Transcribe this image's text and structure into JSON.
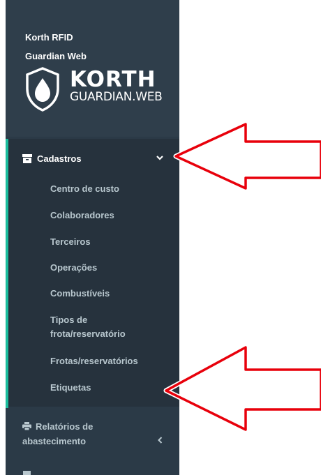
{
  "brand": {
    "line1": "Korth RFID",
    "line2": "Guardian Web",
    "logo_word1": "KORTH",
    "logo_word2": "GUARDIAN.WEB",
    "logo_icon": "shield-drop-icon"
  },
  "menu": {
    "active_section": {
      "label": "Cadastros",
      "icon": "archive-icon",
      "chevron": "chevron-down-icon",
      "items": [
        "Centro de custo",
        "Colaboradores",
        "Terceiros",
        "Operações",
        "Combustíveis",
        "Tipos de frota/reservatório",
        "Frotas/reservatórios",
        "Etiquetas"
      ]
    },
    "next_section": {
      "label": "Relatórios de abastecimento",
      "icon": "printer-icon",
      "chevron": "chevron-left-icon"
    }
  },
  "annotations": {
    "arrow_color": "#e8000b",
    "outline_color": "#ffffff"
  },
  "colors": {
    "sidebar_bg": "#2b3a47",
    "active_bg": "#26323d",
    "accent": "#1abc9c",
    "submenu_text": "#b8c7ce"
  }
}
